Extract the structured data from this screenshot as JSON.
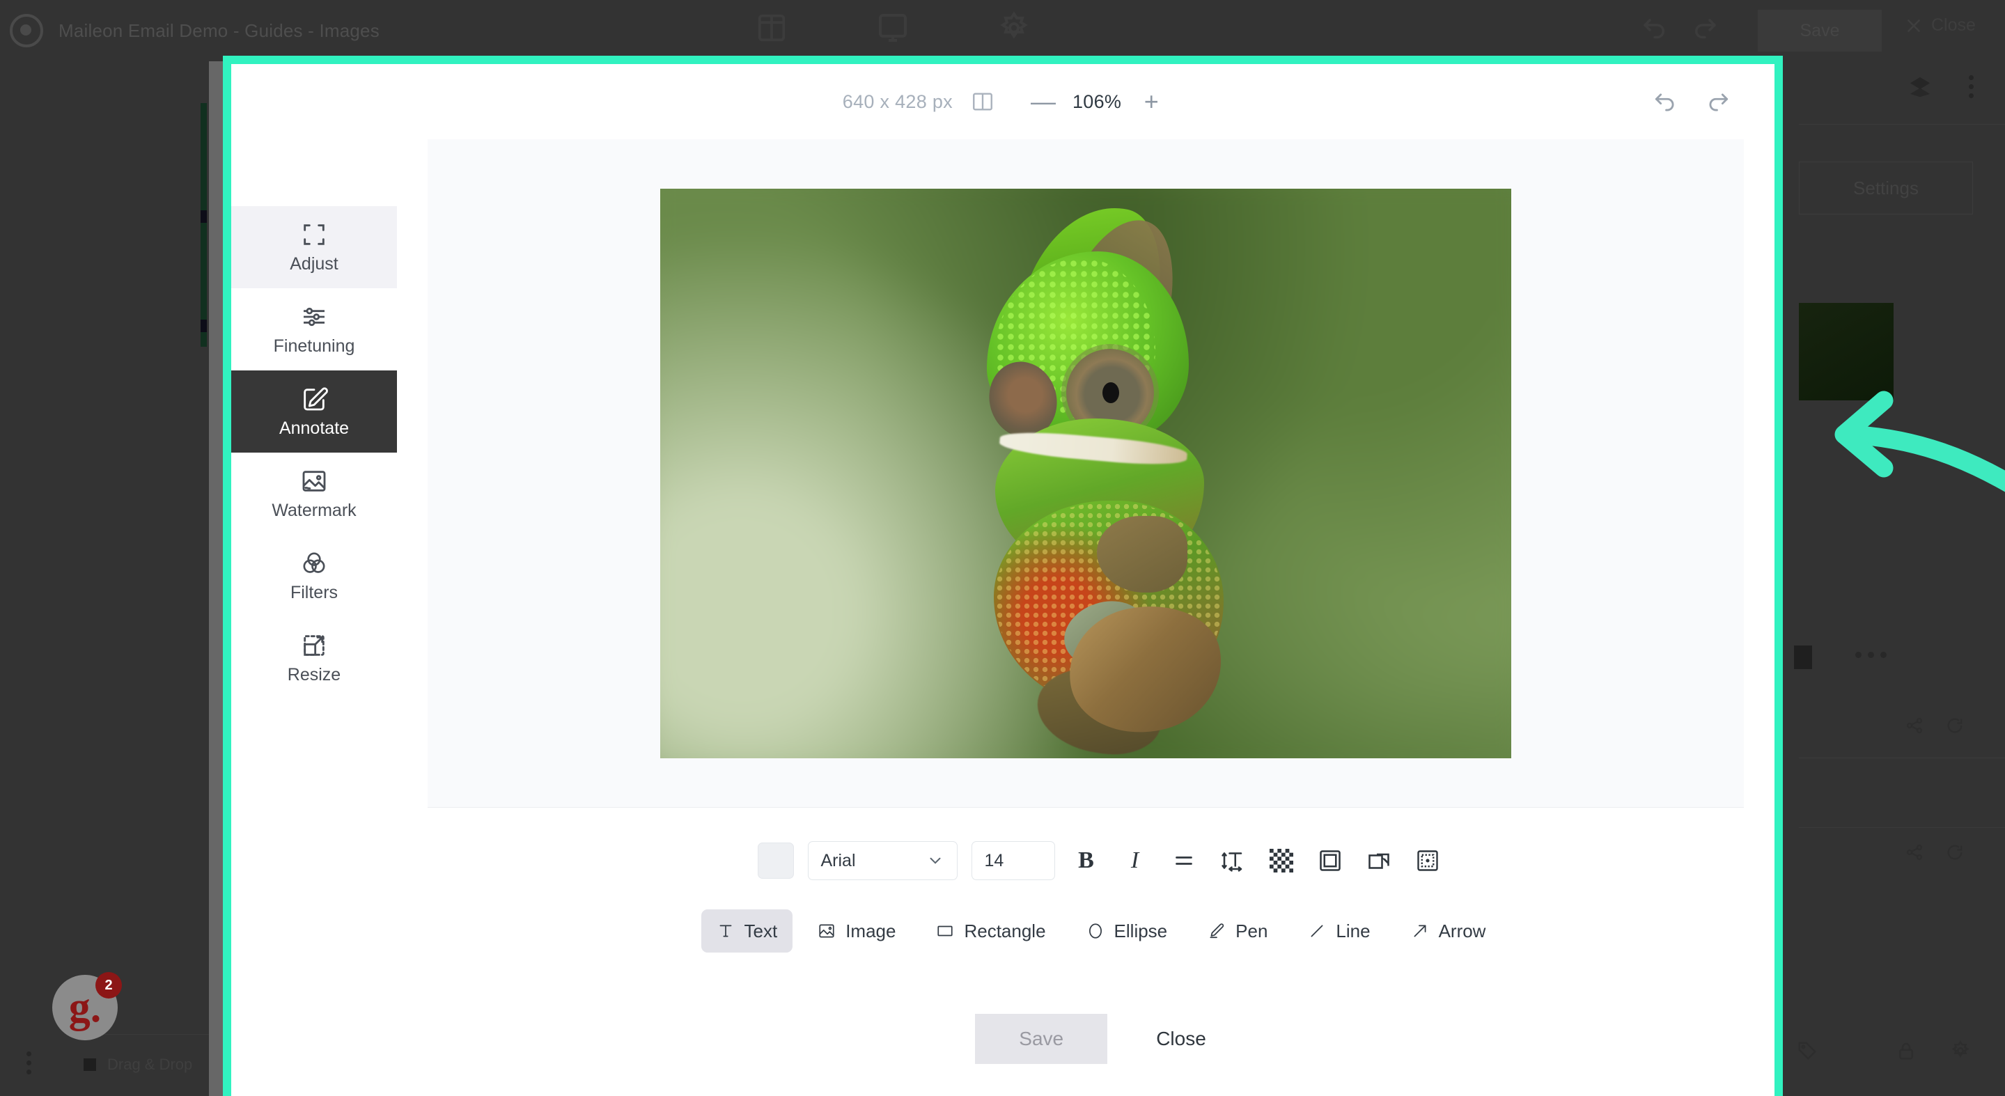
{
  "app": {
    "title": "Maileon Email Demo - Guides - Images",
    "logo_icon": "maileon-logo-icon",
    "toolbar": {
      "grid_icon": "layout-grid-icon",
      "monitor_icon": "desktop-preview-icon",
      "gear_icon": "settings-gear-icon",
      "undo_icon": "undo-icon",
      "redo_icon": "redo-icon",
      "save_label": "Save",
      "close_label": "Close",
      "close_icon": "close-x-icon"
    },
    "right_panel": {
      "settings_label": "Settings",
      "layers_icon": "layers-icon",
      "kebab_icon": "more-vertical-icon",
      "link_icon": "link-icon",
      "reload_icon": "reload-icon"
    },
    "bottom_bar": {
      "drag_drop_label": "Drag & Drop",
      "kebab_icon": "more-vertical-icon"
    },
    "avatar": {
      "initial": "g.",
      "badge_count": "2"
    },
    "annotation": {
      "arrow_icon": "curved-arrow-left-icon",
      "color": "#3eeabf"
    },
    "highlight_color": "#31f2c0"
  },
  "editor": {
    "header": {
      "dimensions": "640 x 428 px",
      "compare_icon": "compare-view-icon",
      "zoom_out_label": "—",
      "zoom_value": "106%",
      "zoom_in_label": "+",
      "undo_icon": "undo-icon",
      "redo_icon": "redo-icon"
    },
    "tools": [
      {
        "label": "Adjust",
        "icon": "crop-frame-icon",
        "state": "hover"
      },
      {
        "label": "Finetuning",
        "icon": "sliders-icon",
        "state": "normal"
      },
      {
        "label": "Annotate",
        "icon": "pencil-box-icon",
        "state": "active"
      },
      {
        "label": "Watermark",
        "icon": "image-icon",
        "state": "normal"
      },
      {
        "label": "Filters",
        "icon": "venn-circles-icon",
        "state": "normal"
      },
      {
        "label": "Resize",
        "icon": "resize-arrow-icon",
        "state": "normal"
      }
    ],
    "canvas": {
      "image_alt": "chameleon-photo"
    },
    "text_options": {
      "color_swatch_icon": "color-swatch-icon",
      "font_family": "Arial",
      "font_dropdown_icon": "chevron-down-icon",
      "font_size": "14",
      "bold_label": "B",
      "italic_label": "I",
      "align_icon": "text-align-icon",
      "text_spacing_icon": "text-spacing-icon",
      "opacity_icon": "opacity-checkerboard-icon",
      "stroke_icon": "stroke-square-icon",
      "shadow_icon": "shadow-square-icon",
      "position_icon": "position-square-icon"
    },
    "shape_tools": [
      {
        "label": "Text",
        "icon": "text-t-icon",
        "active": true
      },
      {
        "label": "Image",
        "icon": "image-icon",
        "active": false
      },
      {
        "label": "Rectangle",
        "icon": "rectangle-icon",
        "active": false
      },
      {
        "label": "Ellipse",
        "icon": "ellipse-icon",
        "active": false
      },
      {
        "label": "Pen",
        "icon": "pen-icon",
        "active": false
      },
      {
        "label": "Line",
        "icon": "line-icon",
        "active": false
      },
      {
        "label": "Arrow",
        "icon": "arrow-icon",
        "active": false
      }
    ],
    "footer": {
      "save_label": "Save",
      "close_label": "Close"
    }
  }
}
